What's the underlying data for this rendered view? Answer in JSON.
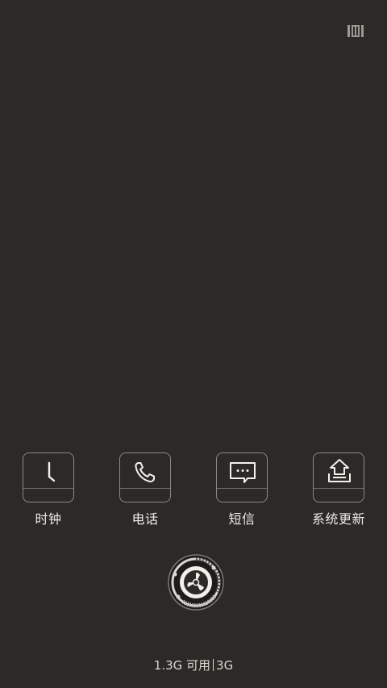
{
  "status": {
    "top_right_icon": "notification-shade-icon"
  },
  "dock": {
    "apps": [
      {
        "label": "时钟",
        "icon": "clock-icon"
      },
      {
        "label": "电话",
        "icon": "phone-icon"
      },
      {
        "label": "短信",
        "icon": "message-icon"
      },
      {
        "label": "系统更新",
        "icon": "system-update-icon"
      }
    ]
  },
  "cleaner": {
    "icon": "cleaner-fan-icon"
  },
  "storage": {
    "free": "1.3G 可用",
    "network": "3G"
  },
  "colors": {
    "background": "#2b2a27",
    "tile_border": "#8d8a84",
    "text": "#ecebe6"
  }
}
